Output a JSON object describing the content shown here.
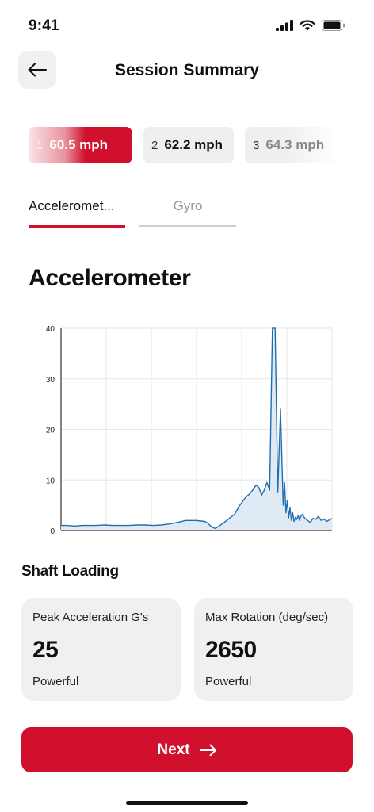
{
  "status": {
    "time": "9:41"
  },
  "header": {
    "title": "Session Summary",
    "back_icon": "arrow-left-icon"
  },
  "swings": [
    {
      "number": "1",
      "speed": "60.5 mph",
      "selected": true
    },
    {
      "number": "2",
      "speed": "62.2 mph",
      "selected": false
    },
    {
      "number": "3",
      "speed": "64.3 mph",
      "selected": false
    }
  ],
  "tabs": [
    {
      "label": "Acceleromet...",
      "active": true
    },
    {
      "label": "Gyro",
      "active": false
    }
  ],
  "section": {
    "heading": "Accelerometer"
  },
  "chart_data": {
    "type": "area",
    "title": "",
    "xlabel": "",
    "ylabel": "",
    "ylim": [
      0,
      40
    ],
    "yticks": [
      "0",
      "10",
      "20",
      "30",
      "40"
    ],
    "grid": true,
    "series": [
      {
        "x": [
          0,
          0.02,
          0.05,
          0.08,
          0.1,
          0.13,
          0.16,
          0.19,
          0.22,
          0.25,
          0.28,
          0.31,
          0.34,
          0.37,
          0.4,
          0.43,
          0.46,
          0.5,
          0.53,
          0.54,
          0.55,
          0.56,
          0.57,
          0.6,
          0.63,
          0.64,
          0.66,
          0.68,
          0.7,
          0.71,
          0.72,
          0.73,
          0.74,
          0.75,
          0.76,
          0.77,
          0.78,
          0.79,
          0.8,
          0.81,
          0.82,
          0.825,
          0.83,
          0.835,
          0.84,
          0.845,
          0.85,
          0.855,
          0.86,
          0.865,
          0.87,
          0.875,
          0.88,
          0.885,
          0.89,
          0.9,
          0.91,
          0.92,
          0.93,
          0.94,
          0.95,
          0.96,
          0.97,
          0.98,
          0.99,
          1.0
        ],
        "values": [
          1.0,
          1.0,
          0.9,
          1.0,
          1.0,
          1.0,
          1.1,
          1.0,
          1.0,
          1.0,
          1.1,
          1.1,
          1.0,
          1.1,
          1.3,
          1.6,
          2.0,
          2.0,
          1.8,
          1.5,
          1.0,
          0.6,
          0.4,
          1.5,
          2.8,
          3.2,
          5.0,
          6.5,
          7.5,
          8.2,
          9.0,
          8.5,
          7.0,
          8.0,
          9.5,
          8.0,
          40.0,
          40.0,
          7.5,
          24.0,
          5.0,
          9.5,
          3.5,
          6.0,
          2.5,
          4.5,
          2.0,
          3.5,
          1.8,
          2.6,
          2.2,
          3.0,
          2.0,
          2.8,
          3.2,
          2.4,
          2.0,
          1.6,
          2.4,
          2.2,
          2.8,
          2.0,
          2.3,
          1.8,
          2.1,
          2.4
        ]
      }
    ],
    "colors": {
      "line": "#1f6fb0",
      "fill": "#dce8f4",
      "grid": "#e6e6e6",
      "axis": "#333333"
    }
  },
  "shaft_loading": {
    "title": "Shaft Loading",
    "cards": [
      {
        "label": "Peak Acceleration G's",
        "value": "25",
        "description": "Powerful"
      },
      {
        "label": "Max Rotation (deg/sec)",
        "value": "2650",
        "description": "Powerful"
      }
    ]
  },
  "next_button": {
    "label": "Next",
    "icon": "arrow-right-icon"
  },
  "theme": {
    "accent": "#d0102c",
    "card_bg": "#f0f0f0"
  }
}
